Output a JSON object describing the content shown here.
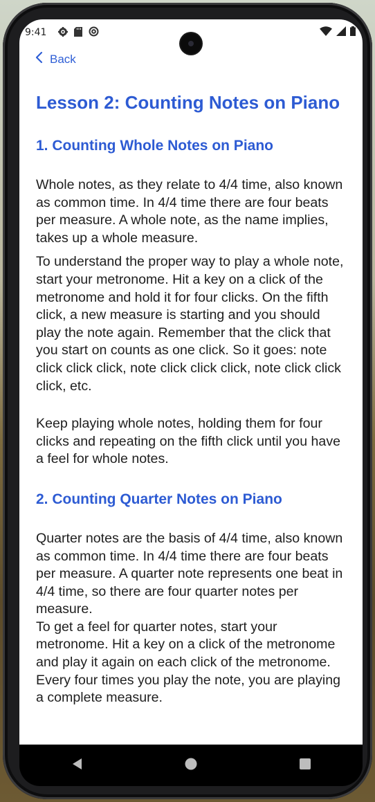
{
  "status": {
    "time": "9:41",
    "left_icons": [
      "gear-icon",
      "sd-card-icon",
      "at-sign-icon"
    ],
    "right_icons": [
      "wifi-icon",
      "signal-icon",
      "battery-icon"
    ]
  },
  "nav": {
    "back_label": "Back"
  },
  "lesson": {
    "title": "Lesson 2: Counting Notes on Piano",
    "sections": [
      {
        "heading": "1. Counting Whole Notes on Piano",
        "paragraphs": [
          "Whole notes, as they relate to 4/4 time, also known as common time. In 4/4 time there are four beats per measure. A whole note, as the name implies, takes up a whole measure.",
          "To understand the proper way to play a whole note, start your metronome. Hit a key on a click of the metronome and hold it for four clicks. On the fifth click, a new measure is starting and you should play the note again. Remember that the click that you start on counts as one click. So it goes: note click click click, note click click click, note click click click, etc.",
          "Keep playing whole notes, holding them for four clicks and repeating on the fifth click until you have a feel for whole notes."
        ]
      },
      {
        "heading": "2. Counting Quarter Notes on Piano",
        "paragraphs": [
          "Quarter notes are the basis of 4/4 time, also known as common time. In 4/4 time there are four beats per measure. A quarter note represents one beat in 4/4 time, so there are four quarter notes per measure.",
          "To get a feel for quarter notes, start your metronome. Hit a key on a click of the metronome and play it again on each click of the metronome. Every four times you play the note, you are playing a complete measure."
        ]
      }
    ]
  },
  "navbar": {
    "icons": [
      "back-triangle-icon",
      "home-circle-icon",
      "recents-square-icon"
    ]
  },
  "colors": {
    "accent": "#2d5bd3",
    "text": "#1e1e1e"
  }
}
